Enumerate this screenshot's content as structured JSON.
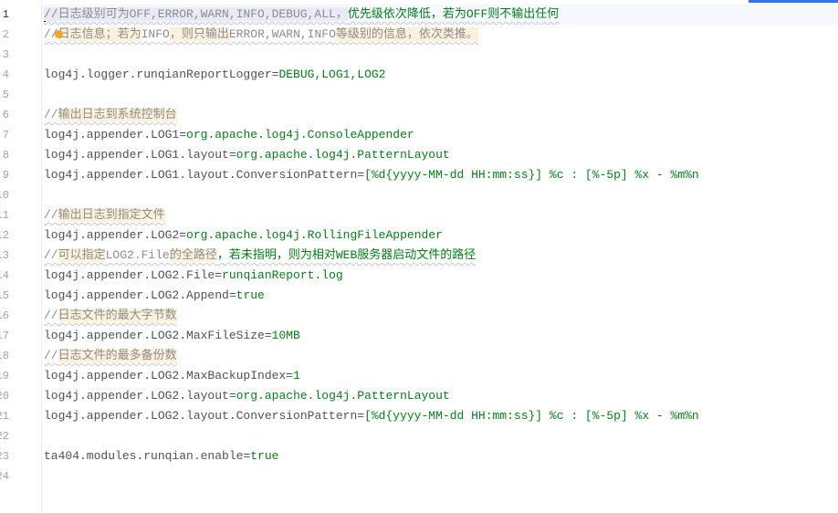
{
  "editor": {
    "accent_color": "#3574f0",
    "current_line": 1,
    "lines": [
      {
        "n": "1",
        "segs": [
          {
            "t": "//日志级别可为OFF,ERROR,WARN,INFO,DEBUG,ALL，",
            "c": "cmt sel"
          },
          {
            "t": "优先级依次降低，若为OFF则不输出任何",
            "c": "cg"
          }
        ]
      },
      {
        "n": "2",
        "segs": [
          {
            "t": "//",
            "c": "cmt"
          },
          {
            "t": "日志信息；若为",
            "c": "cmt hl"
          },
          {
            "t": "INFO",
            "c": "cmt"
          },
          {
            "t": "，则只输出",
            "c": "cmt hl"
          },
          {
            "t": "ERROR,WARN,INFO",
            "c": "cmt"
          },
          {
            "t": "等级别的信息，依次类推。",
            "c": "cmt hl"
          }
        ]
      },
      {
        "n": "3",
        "segs": []
      },
      {
        "n": "4",
        "segs": [
          {
            "t": "log4j.logger.runqianReportLogger",
            "c": "key"
          },
          {
            "t": "=",
            "c": "eq"
          },
          {
            "t": "DEBUG,LOG1,LOG2",
            "c": "val"
          }
        ]
      },
      {
        "n": "5",
        "segs": []
      },
      {
        "n": "6",
        "segs": [
          {
            "t": "//",
            "c": "cmt"
          },
          {
            "t": "输出日志到系统控制台",
            "c": "cmt hl"
          }
        ]
      },
      {
        "n": "7",
        "segs": [
          {
            "t": "log4j.appender.LOG1",
            "c": "key"
          },
          {
            "t": "=",
            "c": "eq"
          },
          {
            "t": "org.apache.log4j.ConsoleAppender",
            "c": "val"
          }
        ]
      },
      {
        "n": "8",
        "segs": [
          {
            "t": "log4j.appender.LOG1.layout",
            "c": "key"
          },
          {
            "t": "=",
            "c": "eq"
          },
          {
            "t": "org.apache.log4j.PatternLayout",
            "c": "val"
          }
        ]
      },
      {
        "n": "9",
        "segs": [
          {
            "t": "log4j.appender.LOG1.layout.ConversionPattern",
            "c": "key"
          },
          {
            "t": "=",
            "c": "eq"
          },
          {
            "t": "[%d{yyyy-MM-dd HH:mm:ss}] %c : [%-5p] %x - %m%n",
            "c": "val"
          }
        ]
      },
      {
        "n": "10",
        "segs": []
      },
      {
        "n": "11",
        "segs": [
          {
            "t": "//",
            "c": "cmt"
          },
          {
            "t": "输出日志到指定文件",
            "c": "cmt hl"
          }
        ]
      },
      {
        "n": "12",
        "segs": [
          {
            "t": "log4j.appender.LOG2",
            "c": "key"
          },
          {
            "t": "=",
            "c": "eq"
          },
          {
            "t": "org.apache.log4j.RollingFileAppender",
            "c": "val"
          }
        ]
      },
      {
        "n": "13",
        "segs": [
          {
            "t": "//",
            "c": "cmt"
          },
          {
            "t": "可以指定",
            "c": "cmt hl"
          },
          {
            "t": "LOG2.File",
            "c": "cmt"
          },
          {
            "t": "的全路径",
            "c": "cmt hl"
          },
          {
            "t": "，若未指明，则为相对WEB服务器启动文件的路径",
            "c": "cg"
          }
        ]
      },
      {
        "n": "14",
        "segs": [
          {
            "t": "log4j.appender.LOG2.File",
            "c": "key"
          },
          {
            "t": "=",
            "c": "eq"
          },
          {
            "t": "runqianReport.log",
            "c": "val"
          }
        ]
      },
      {
        "n": "15",
        "segs": [
          {
            "t": "log4j.appender.LOG2.Append",
            "c": "key"
          },
          {
            "t": "=",
            "c": "eq"
          },
          {
            "t": "true",
            "c": "val"
          }
        ]
      },
      {
        "n": "16",
        "segs": [
          {
            "t": "//",
            "c": "cmt"
          },
          {
            "t": "日志文件的最大字节数",
            "c": "cmt hl"
          }
        ]
      },
      {
        "n": "17",
        "segs": [
          {
            "t": "log4j.appender.LOG2.MaxFileSize",
            "c": "key"
          },
          {
            "t": "=",
            "c": "eq"
          },
          {
            "t": "10MB",
            "c": "val"
          }
        ]
      },
      {
        "n": "18",
        "segs": [
          {
            "t": "//",
            "c": "cmt"
          },
          {
            "t": "日志文件的最多备份数",
            "c": "cmt hl"
          }
        ]
      },
      {
        "n": "19",
        "segs": [
          {
            "t": "log4j.appender.LOG2.MaxBackupIndex",
            "c": "key"
          },
          {
            "t": "=",
            "c": "eq"
          },
          {
            "t": "1",
            "c": "val"
          }
        ]
      },
      {
        "n": "20",
        "segs": [
          {
            "t": "log4j.appender.LOG2.layout",
            "c": "key"
          },
          {
            "t": "=",
            "c": "eq"
          },
          {
            "t": "org.apache.log4j.PatternLayout",
            "c": "val"
          }
        ]
      },
      {
        "n": "21",
        "segs": [
          {
            "t": "log4j.appender.LOG2.layout.ConversionPattern",
            "c": "key"
          },
          {
            "t": "=",
            "c": "eq"
          },
          {
            "t": "[%d{yyyy-MM-dd HH:mm:ss}] %c : [%-5p] %x - %m%n",
            "c": "val"
          }
        ]
      },
      {
        "n": "22",
        "segs": []
      },
      {
        "n": "23",
        "segs": [
          {
            "t": "ta404.modules.runqian.enable",
            "c": "key"
          },
          {
            "t": "=",
            "c": "eq"
          },
          {
            "t": "true",
            "c": "val"
          }
        ]
      },
      {
        "n": "24",
        "segs": []
      }
    ]
  }
}
